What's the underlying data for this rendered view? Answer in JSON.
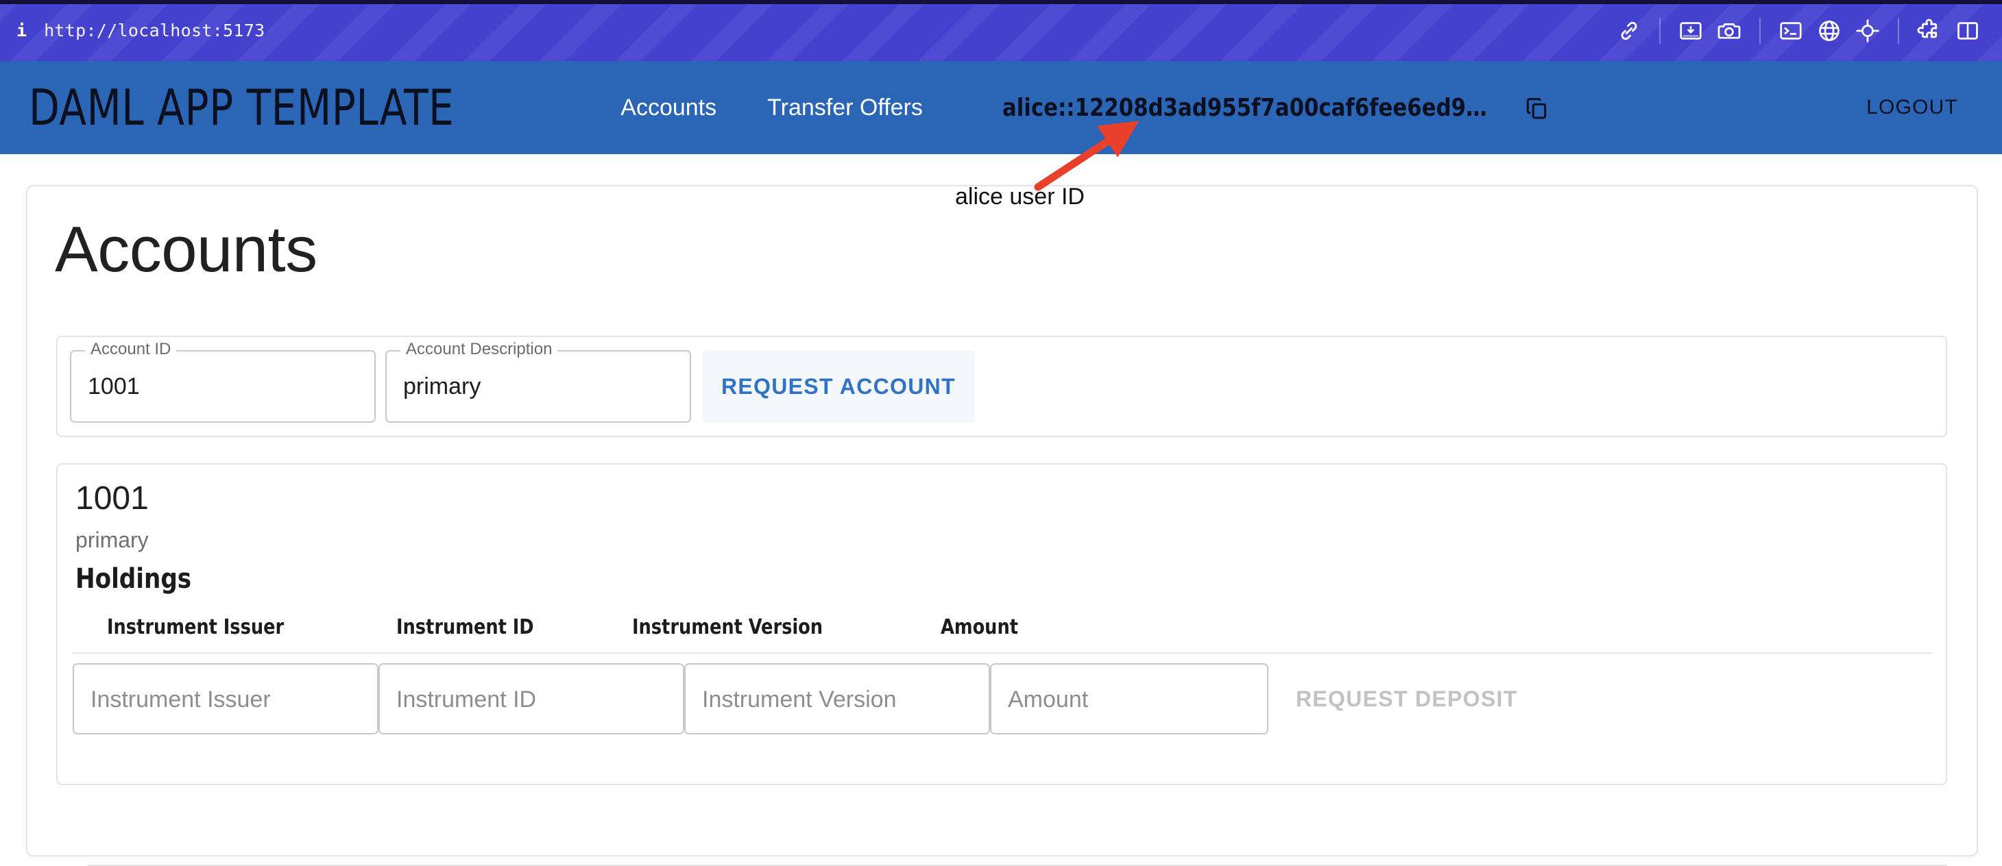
{
  "browser_bar": {
    "info_icon": "info-icon",
    "url": "http://localhost:5173",
    "icons": [
      {
        "name": "link-icon"
      },
      {
        "name": "divider"
      },
      {
        "name": "image-download-icon"
      },
      {
        "name": "camera-icon"
      },
      {
        "name": "divider"
      },
      {
        "name": "terminal-icon"
      },
      {
        "name": "globe-icon"
      },
      {
        "name": "crosshair-target-icon"
      },
      {
        "name": "divider"
      },
      {
        "name": "puzzle-piece-icon"
      },
      {
        "name": "split-panel-icon"
      }
    ],
    "colors": {
      "background": "#4541cf",
      "top_edge": "#120f3a"
    }
  },
  "appbar": {
    "title": "DAML APP TEMPLATE",
    "nav": [
      {
        "label": "Accounts"
      },
      {
        "label": "Transfer Offers"
      }
    ],
    "user_id": "alice::12208d3ad955f7a00caf6fee6ed9…",
    "copy_icon": "copy-icon",
    "logout_label": "LOGOUT",
    "colors": {
      "background": "#2b66b6",
      "title_text": "#0b1020",
      "nav_text": "#ffffff"
    }
  },
  "annotation": {
    "label": "alice user ID",
    "arrow_color": "#e8402a"
  },
  "main": {
    "page_title": "Accounts",
    "request_account_form": {
      "account_id": {
        "label": "Account ID",
        "value": "1001"
      },
      "account_description": {
        "label": "Account Description",
        "value": "primary"
      },
      "submit_label": "REQUEST ACCOUNT",
      "submit_color": "#3072c4"
    },
    "account_card": {
      "account_number": "1001",
      "account_description": "primary",
      "holdings_title": "Holdings",
      "table": {
        "columns": [
          "Instrument Issuer",
          "Instrument ID",
          "Instrument Version",
          "Amount"
        ],
        "rows": [],
        "new_row_inputs": [
          {
            "placeholder": "Instrument Issuer",
            "value": ""
          },
          {
            "placeholder": "Instrument ID",
            "value": ""
          },
          {
            "placeholder": "Instrument Version",
            "value": ""
          },
          {
            "placeholder": "Amount",
            "value": ""
          }
        ],
        "submit_label": "REQUEST DEPOSIT",
        "submit_disabled": true
      }
    }
  }
}
